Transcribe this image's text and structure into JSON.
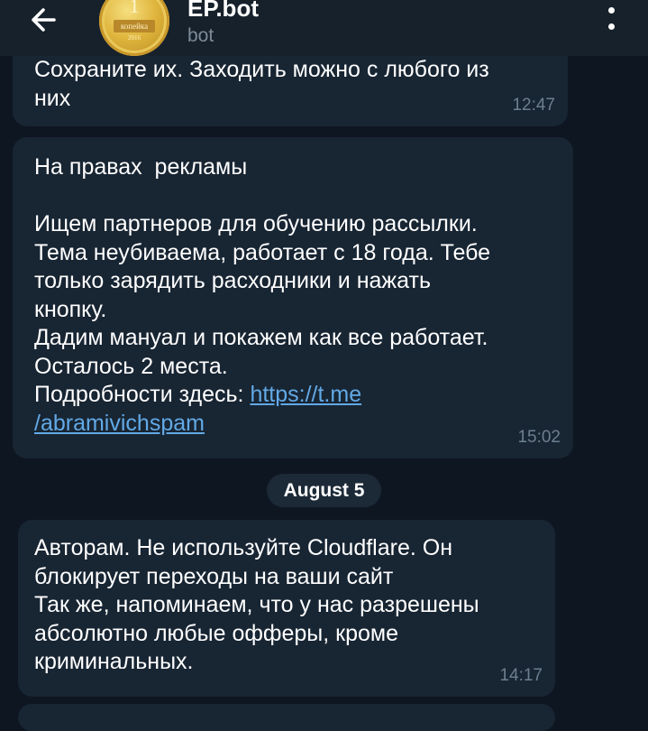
{
  "header": {
    "title": "EP.bot",
    "subtitle": "bot",
    "avatar": {
      "number": "1",
      "band_text": "копейка",
      "year": "2016"
    }
  },
  "messages": [
    {
      "text": "Сохраните их. Заходить можно с любого из\nних",
      "time": "12:47"
    },
    {
      "text_before_link": "На правах  рекламы\n\nИщем партнеров для обучению рассылки.\nТема неубиваема, работает с 18 года. Тебе\nтолько зарядить расходники и нажать\nкнопку.\nДадим мануал и покажем как все работает.\nОсталось 2 места.\nПодробности здесь: ",
      "link_line1": "https://t.me",
      "link_line2": "/abramivichspam",
      "time": "15:02"
    },
    {
      "text": "Авторам. Не используйте Cloudflare. Он\nблокирует переходы на ваши сайт\nТак же, напоминаем, что у нас разрешены\nабсолютно любые офферы, кроме\nкриминальных.",
      "time": "14:17"
    }
  ],
  "date_separator": "August 5",
  "colors": {
    "background": "#0e1621",
    "header": "#17212b",
    "bubble": "#182533",
    "link": "#62a9e6",
    "meta_text": "#6d7f8f"
  },
  "icons": {
    "back": "arrow-left-icon",
    "menu": "more-vertical-icon"
  }
}
